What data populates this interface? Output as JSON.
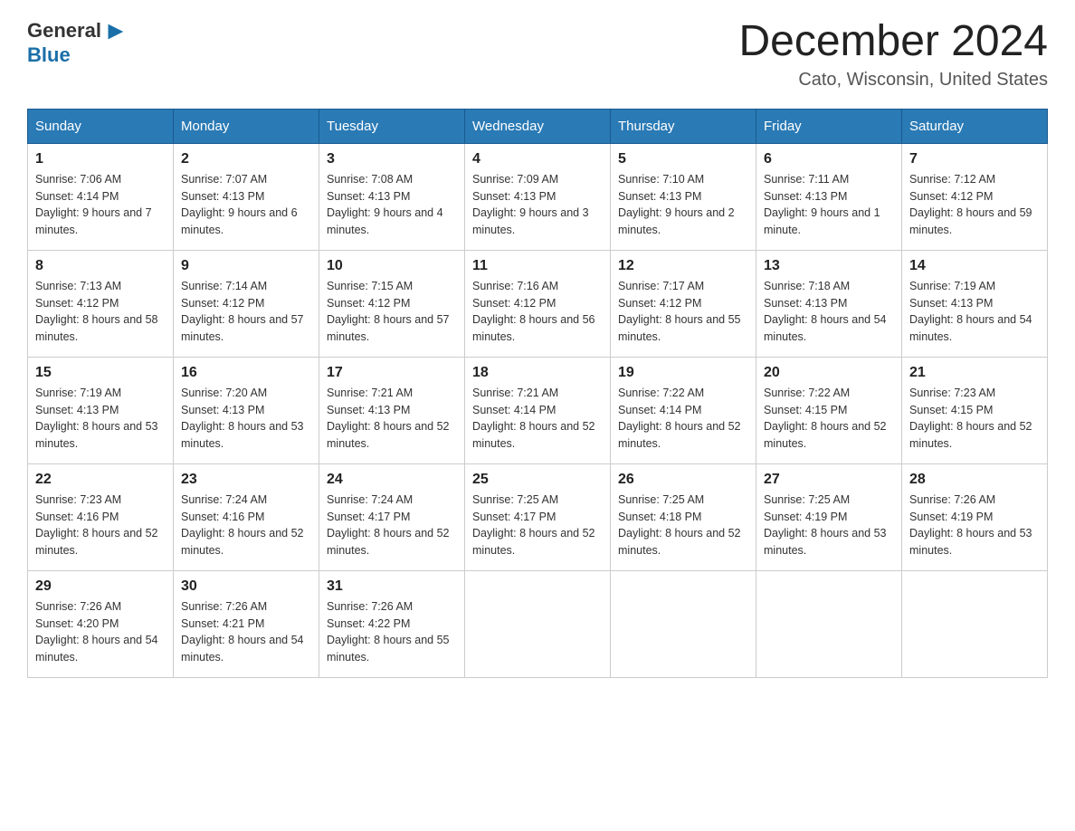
{
  "header": {
    "logo_general": "General",
    "logo_blue": "Blue",
    "month_title": "December 2024",
    "location": "Cato, Wisconsin, United States"
  },
  "days_of_week": [
    "Sunday",
    "Monday",
    "Tuesday",
    "Wednesday",
    "Thursday",
    "Friday",
    "Saturday"
  ],
  "weeks": [
    [
      {
        "day": "1",
        "sunrise": "Sunrise: 7:06 AM",
        "sunset": "Sunset: 4:14 PM",
        "daylight": "Daylight: 9 hours and 7 minutes."
      },
      {
        "day": "2",
        "sunrise": "Sunrise: 7:07 AM",
        "sunset": "Sunset: 4:13 PM",
        "daylight": "Daylight: 9 hours and 6 minutes."
      },
      {
        "day": "3",
        "sunrise": "Sunrise: 7:08 AM",
        "sunset": "Sunset: 4:13 PM",
        "daylight": "Daylight: 9 hours and 4 minutes."
      },
      {
        "day": "4",
        "sunrise": "Sunrise: 7:09 AM",
        "sunset": "Sunset: 4:13 PM",
        "daylight": "Daylight: 9 hours and 3 minutes."
      },
      {
        "day": "5",
        "sunrise": "Sunrise: 7:10 AM",
        "sunset": "Sunset: 4:13 PM",
        "daylight": "Daylight: 9 hours and 2 minutes."
      },
      {
        "day": "6",
        "sunrise": "Sunrise: 7:11 AM",
        "sunset": "Sunset: 4:13 PM",
        "daylight": "Daylight: 9 hours and 1 minute."
      },
      {
        "day": "7",
        "sunrise": "Sunrise: 7:12 AM",
        "sunset": "Sunset: 4:12 PM",
        "daylight": "Daylight: 8 hours and 59 minutes."
      }
    ],
    [
      {
        "day": "8",
        "sunrise": "Sunrise: 7:13 AM",
        "sunset": "Sunset: 4:12 PM",
        "daylight": "Daylight: 8 hours and 58 minutes."
      },
      {
        "day": "9",
        "sunrise": "Sunrise: 7:14 AM",
        "sunset": "Sunset: 4:12 PM",
        "daylight": "Daylight: 8 hours and 57 minutes."
      },
      {
        "day": "10",
        "sunrise": "Sunrise: 7:15 AM",
        "sunset": "Sunset: 4:12 PM",
        "daylight": "Daylight: 8 hours and 57 minutes."
      },
      {
        "day": "11",
        "sunrise": "Sunrise: 7:16 AM",
        "sunset": "Sunset: 4:12 PM",
        "daylight": "Daylight: 8 hours and 56 minutes."
      },
      {
        "day": "12",
        "sunrise": "Sunrise: 7:17 AM",
        "sunset": "Sunset: 4:12 PM",
        "daylight": "Daylight: 8 hours and 55 minutes."
      },
      {
        "day": "13",
        "sunrise": "Sunrise: 7:18 AM",
        "sunset": "Sunset: 4:13 PM",
        "daylight": "Daylight: 8 hours and 54 minutes."
      },
      {
        "day": "14",
        "sunrise": "Sunrise: 7:19 AM",
        "sunset": "Sunset: 4:13 PM",
        "daylight": "Daylight: 8 hours and 54 minutes."
      }
    ],
    [
      {
        "day": "15",
        "sunrise": "Sunrise: 7:19 AM",
        "sunset": "Sunset: 4:13 PM",
        "daylight": "Daylight: 8 hours and 53 minutes."
      },
      {
        "day": "16",
        "sunrise": "Sunrise: 7:20 AM",
        "sunset": "Sunset: 4:13 PM",
        "daylight": "Daylight: 8 hours and 53 minutes."
      },
      {
        "day": "17",
        "sunrise": "Sunrise: 7:21 AM",
        "sunset": "Sunset: 4:13 PM",
        "daylight": "Daylight: 8 hours and 52 minutes."
      },
      {
        "day": "18",
        "sunrise": "Sunrise: 7:21 AM",
        "sunset": "Sunset: 4:14 PM",
        "daylight": "Daylight: 8 hours and 52 minutes."
      },
      {
        "day": "19",
        "sunrise": "Sunrise: 7:22 AM",
        "sunset": "Sunset: 4:14 PM",
        "daylight": "Daylight: 8 hours and 52 minutes."
      },
      {
        "day": "20",
        "sunrise": "Sunrise: 7:22 AM",
        "sunset": "Sunset: 4:15 PM",
        "daylight": "Daylight: 8 hours and 52 minutes."
      },
      {
        "day": "21",
        "sunrise": "Sunrise: 7:23 AM",
        "sunset": "Sunset: 4:15 PM",
        "daylight": "Daylight: 8 hours and 52 minutes."
      }
    ],
    [
      {
        "day": "22",
        "sunrise": "Sunrise: 7:23 AM",
        "sunset": "Sunset: 4:16 PM",
        "daylight": "Daylight: 8 hours and 52 minutes."
      },
      {
        "day": "23",
        "sunrise": "Sunrise: 7:24 AM",
        "sunset": "Sunset: 4:16 PM",
        "daylight": "Daylight: 8 hours and 52 minutes."
      },
      {
        "day": "24",
        "sunrise": "Sunrise: 7:24 AM",
        "sunset": "Sunset: 4:17 PM",
        "daylight": "Daylight: 8 hours and 52 minutes."
      },
      {
        "day": "25",
        "sunrise": "Sunrise: 7:25 AM",
        "sunset": "Sunset: 4:17 PM",
        "daylight": "Daylight: 8 hours and 52 minutes."
      },
      {
        "day": "26",
        "sunrise": "Sunrise: 7:25 AM",
        "sunset": "Sunset: 4:18 PM",
        "daylight": "Daylight: 8 hours and 52 minutes."
      },
      {
        "day": "27",
        "sunrise": "Sunrise: 7:25 AM",
        "sunset": "Sunset: 4:19 PM",
        "daylight": "Daylight: 8 hours and 53 minutes."
      },
      {
        "day": "28",
        "sunrise": "Sunrise: 7:26 AM",
        "sunset": "Sunset: 4:19 PM",
        "daylight": "Daylight: 8 hours and 53 minutes."
      }
    ],
    [
      {
        "day": "29",
        "sunrise": "Sunrise: 7:26 AM",
        "sunset": "Sunset: 4:20 PM",
        "daylight": "Daylight: 8 hours and 54 minutes."
      },
      {
        "day": "30",
        "sunrise": "Sunrise: 7:26 AM",
        "sunset": "Sunset: 4:21 PM",
        "daylight": "Daylight: 8 hours and 54 minutes."
      },
      {
        "day": "31",
        "sunrise": "Sunrise: 7:26 AM",
        "sunset": "Sunset: 4:22 PM",
        "daylight": "Daylight: 8 hours and 55 minutes."
      },
      null,
      null,
      null,
      null
    ]
  ]
}
